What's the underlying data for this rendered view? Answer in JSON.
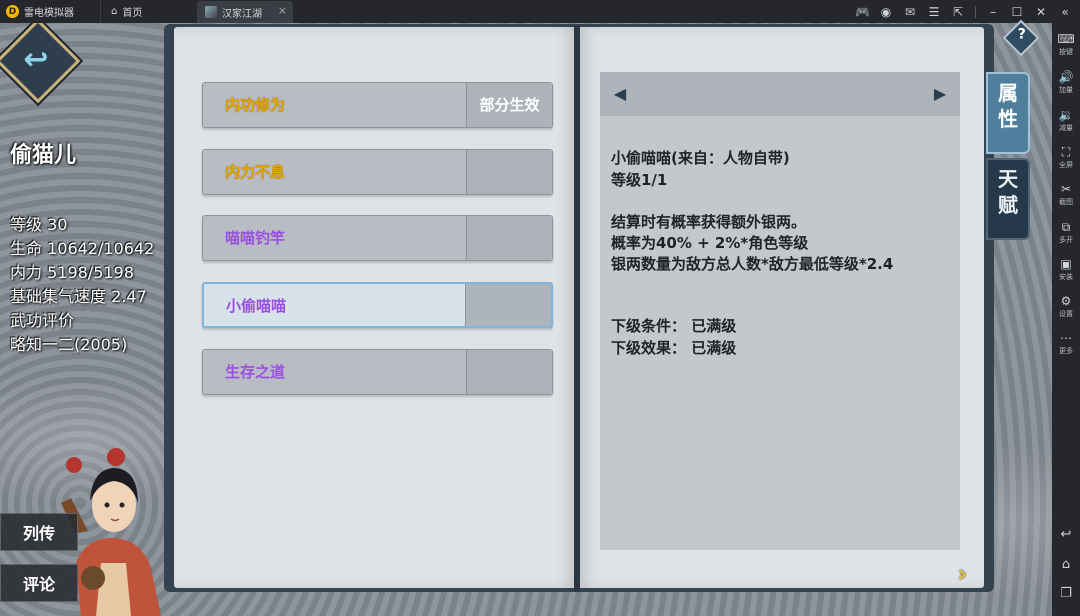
{
  "emulator": {
    "app_name": "雷电模拟器",
    "tabs": [
      {
        "label": "首页"
      },
      {
        "label": "汉家江湖"
      }
    ],
    "sidebar": [
      {
        "label": "按键"
      },
      {
        "label": "加量"
      },
      {
        "label": "减量"
      },
      {
        "label": "全屏"
      },
      {
        "label": "截图"
      },
      {
        "label": "多开"
      },
      {
        "label": "安装"
      },
      {
        "label": "设置"
      },
      {
        "label": "更多"
      }
    ]
  },
  "character": {
    "name": "偷猫儿",
    "stats": [
      "等级 30",
      "生命 10642/10642",
      "内力 5198/5198",
      "基础集气速度 2.47",
      "武功评价",
      "略知一二(2005)"
    ]
  },
  "side_buttons": {
    "biography": "列传",
    "comment": "评论"
  },
  "skills": [
    {
      "name": "内功修为",
      "status": "部分生效",
      "rarity": "gold"
    },
    {
      "name": "内力不息",
      "status": "",
      "rarity": "gold"
    },
    {
      "name": "喵喵钓竿",
      "status": "",
      "rarity": "purple"
    },
    {
      "name": "小偷喵喵",
      "status": "",
      "rarity": "purple",
      "selected": true
    },
    {
      "name": "生存之道",
      "status": "",
      "rarity": "purple"
    }
  ],
  "detail": {
    "title": "小偷喵喵(来自：人物自带)",
    "level": "等级1/1",
    "description": [
      "结算时有概率获得额外银两。",
      "概率为40% + 2%*角色等级",
      "银两数量为敌方总人数*敌方最低等级*2.4"
    ],
    "next_condition": "下级条件：  已满级",
    "next_effect": "下级效果：  已满级"
  },
  "book_tabs": {
    "attributes": "属性",
    "talents": "天赋"
  },
  "help_label": "?",
  "colors": {
    "gold_skill": "#e7a500",
    "purple_skill": "#9b4fe0",
    "book_cover": "#34434f",
    "page": "#dfe3e6"
  }
}
